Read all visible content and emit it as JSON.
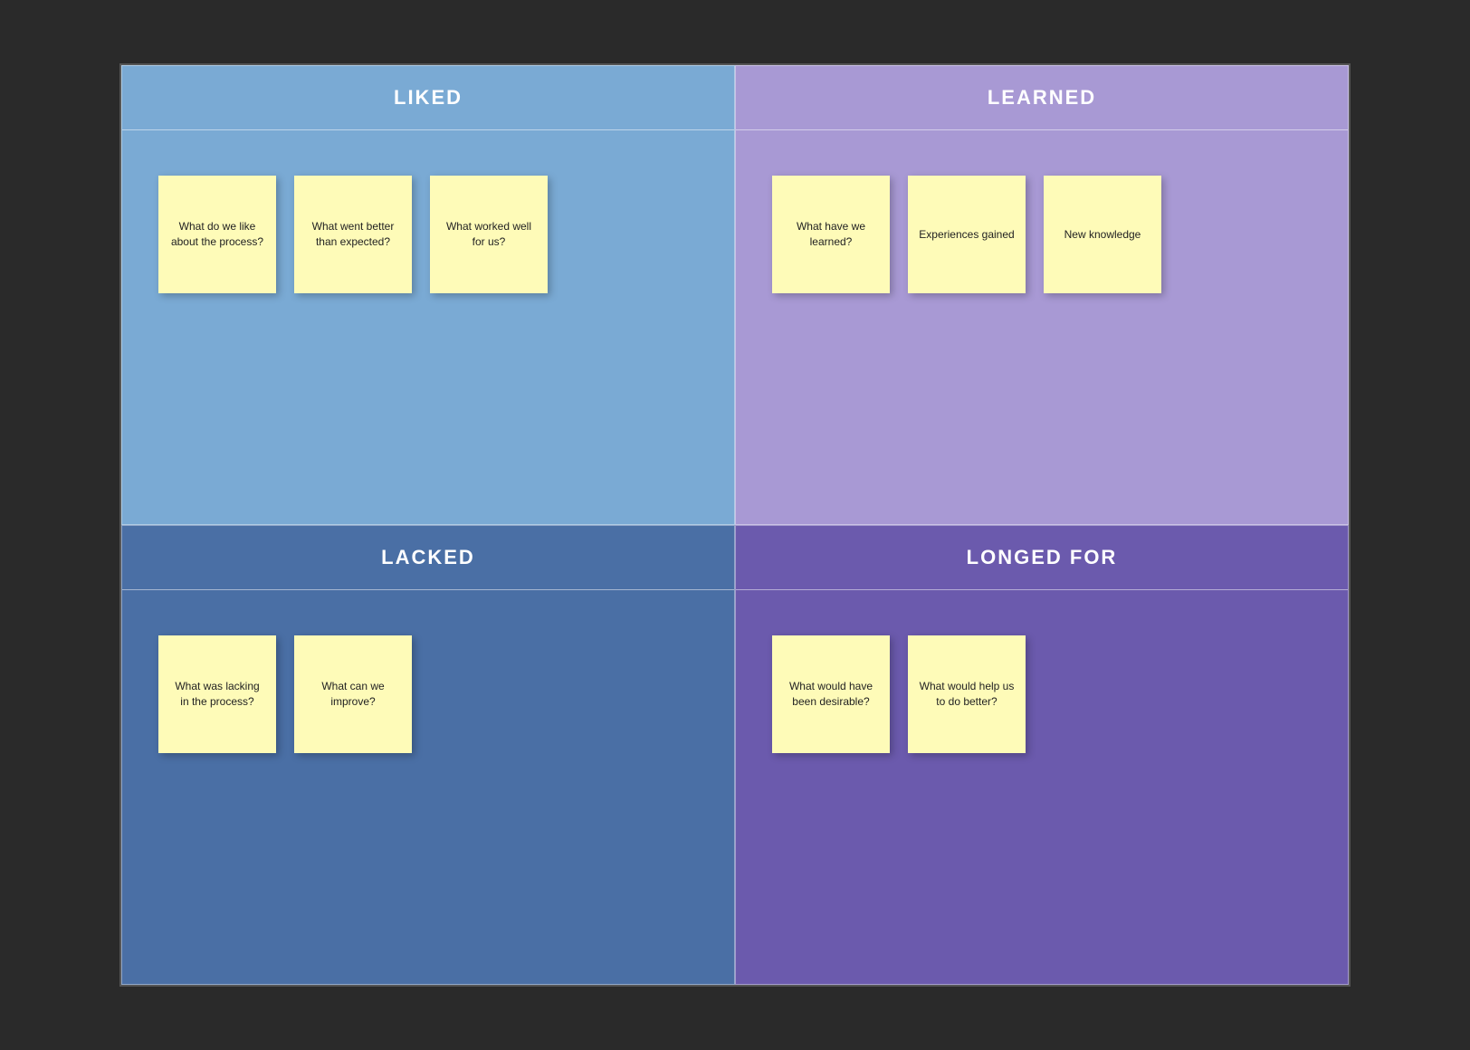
{
  "quadrants": {
    "liked": {
      "title": "LIKED",
      "notes": [
        "What do we like about the process?",
        "What went better than expected?",
        "What worked well for us?"
      ]
    },
    "learned": {
      "title": "LEARNED",
      "notes": [
        "What have we learned?",
        "Experiences gained",
        "New knowledge"
      ]
    },
    "lacked": {
      "title": "LACKED",
      "notes": [
        "What was lacking in the process?",
        "What can we improve?"
      ]
    },
    "longed_for": {
      "title": "LONGED FOR",
      "notes": [
        "What would have been desirable?",
        "What would help us to do better?"
      ]
    }
  }
}
